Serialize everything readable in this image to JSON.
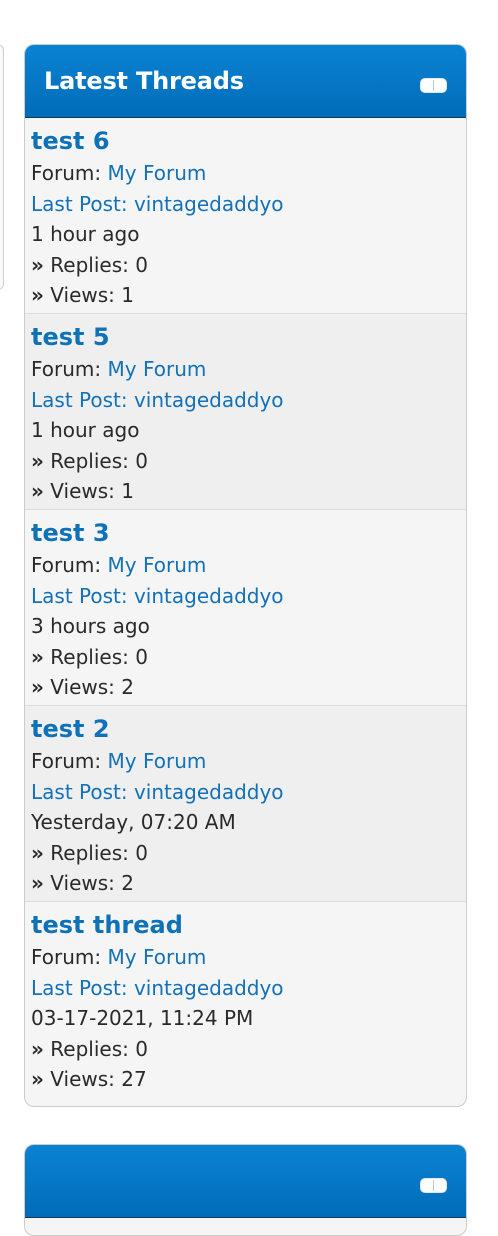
{
  "latest_threads": {
    "title": "Latest Threads",
    "forum_prefix": "Forum:",
    "replies_prefix": "Replies:",
    "views_prefix": "Views:",
    "raquo": "»",
    "threads": [
      {
        "title": "test 6",
        "forum": "My Forum",
        "last_post": "Last Post: vintagedaddyo",
        "time": "1 hour ago",
        "replies": "0",
        "views": "1"
      },
      {
        "title": "test 5",
        "forum": "My Forum",
        "last_post": "Last Post: vintagedaddyo",
        "time": "1 hour ago",
        "replies": "0",
        "views": "1"
      },
      {
        "title": "test 3",
        "forum": "My Forum",
        "last_post": "Last Post: vintagedaddyo",
        "time": "3 hours ago",
        "replies": "0",
        "views": "2"
      },
      {
        "title": "test 2",
        "forum": "My Forum",
        "last_post": "Last Post: vintagedaddyo",
        "time": "Yesterday, 07:20 AM",
        "replies": "0",
        "views": "2"
      },
      {
        "title": "test thread",
        "forum": "My Forum",
        "last_post": "Last Post: vintagedaddyo",
        "time": "03-17-2021, 11:24 PM",
        "replies": "0",
        "views": "27"
      }
    ]
  },
  "colors": {
    "header_blue": "#0276c6",
    "link_blue": "#1271b9"
  },
  "icons": {
    "collapse": "collapse-icon"
  }
}
